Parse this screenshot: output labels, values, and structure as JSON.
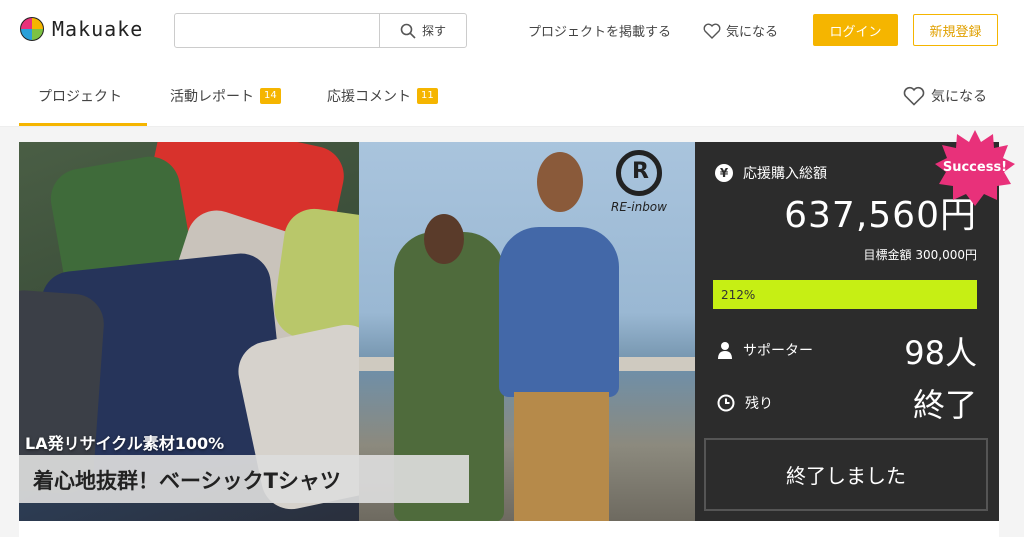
{
  "header": {
    "brand": "Makuake",
    "search": {
      "value": "",
      "placeholder": "",
      "button_label": "探す"
    },
    "post_project": "プロジェクトを掲載する",
    "favorite": "気になる",
    "login": "ログイン",
    "signup": "新規登録"
  },
  "tabs": [
    {
      "label": "プロジェクト",
      "badge": ""
    },
    {
      "label": "活動レポート",
      "badge": "14"
    },
    {
      "label": "応援コメント",
      "badge": "11"
    }
  ],
  "tabs_favorite": "気になる",
  "hero": {
    "brand_mark": "R",
    "brand_name": "RE-inbow",
    "catch_sub": "LA発リサイクル素材100%",
    "catch_main": "着心地抜群！ベーシックTシャツ"
  },
  "panel": {
    "total_label": "応援購入総額",
    "total_value": "637,560円",
    "goal": "目標金額 300,000円",
    "progress_text": "212%",
    "progress_fraction": 1.0,
    "supporters_label": "サポーター",
    "supporters_value": "98人",
    "remaining_label": "残り",
    "remaining_value": "終了",
    "ended_button": "終了しました",
    "success_badge": "Success!"
  },
  "colors": {
    "accent": "#f5b500",
    "progress": "#c6ef14",
    "panel": "#2c2c2c",
    "success": "#e8317a"
  },
  "icons": [
    "search-icon",
    "heart-icon",
    "yen-icon",
    "person-icon",
    "clock-icon"
  ]
}
